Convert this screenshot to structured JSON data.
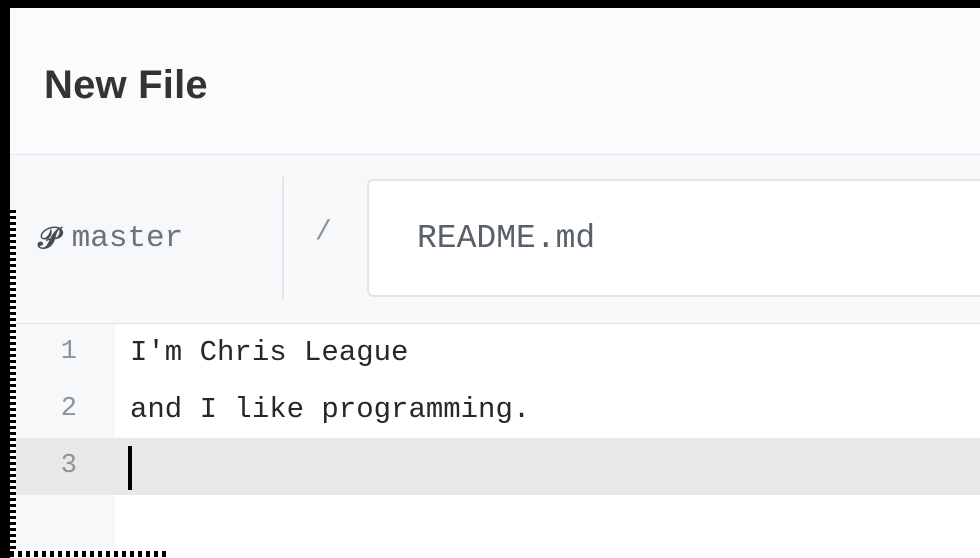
{
  "header": {
    "title": "New File"
  },
  "path": {
    "branch_icon": "git-branch-icon",
    "branch": "master",
    "separator": "/",
    "filename": "README.md"
  },
  "editor": {
    "lines": [
      {
        "number": "1",
        "text": "I'm Chris League"
      },
      {
        "number": "2",
        "text": "and I like programming."
      },
      {
        "number": "3",
        "text": ""
      }
    ],
    "active_line": 3
  }
}
